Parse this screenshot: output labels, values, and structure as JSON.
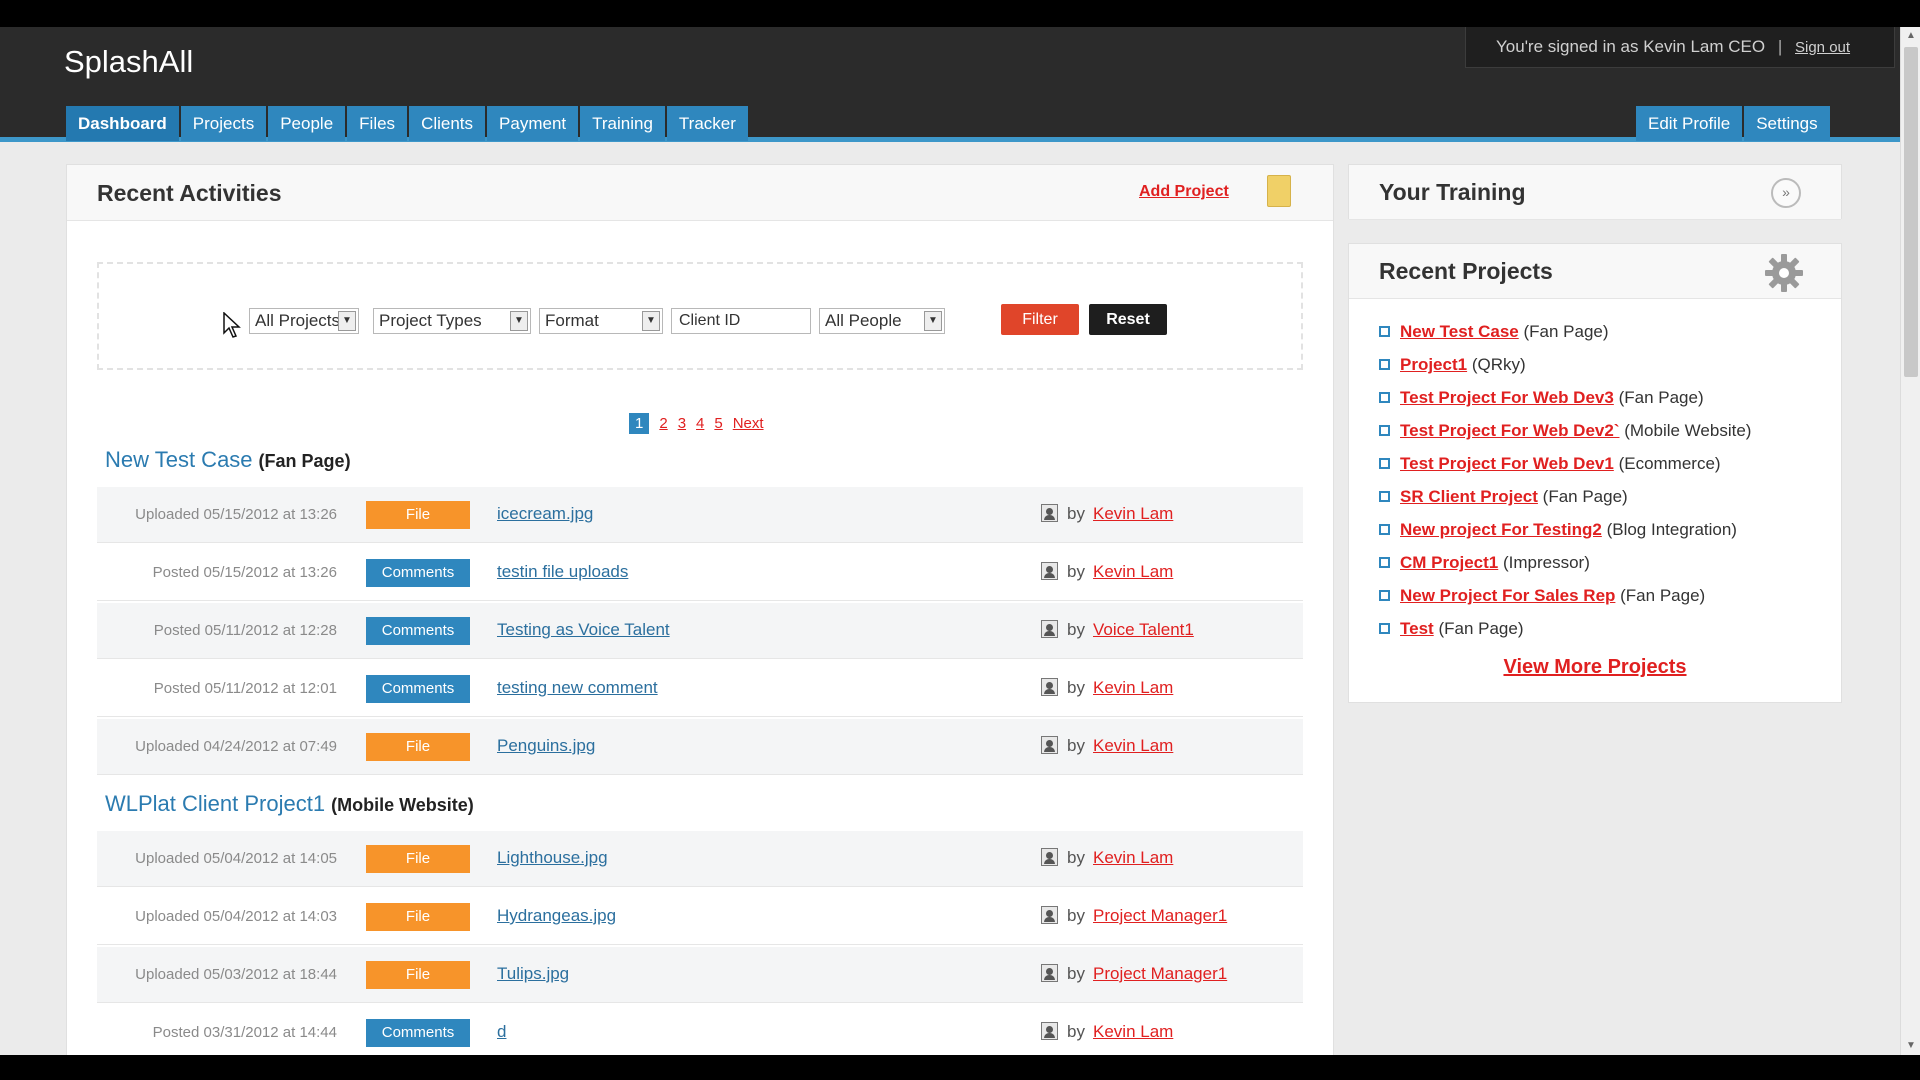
{
  "header": {
    "logo": "SplashAll",
    "user_text": "You're signed in as Kevin Lam CEO",
    "separator": "|",
    "sign_out": "Sign out"
  },
  "nav": {
    "tabs": [
      "Dashboard",
      "Projects",
      "People",
      "Files",
      "Clients",
      "Payment",
      "Training",
      "Tracker"
    ],
    "active": "Dashboard",
    "right_tabs": [
      "Edit Profile",
      "Settings"
    ]
  },
  "activities": {
    "title": "Recent Activities",
    "add_project": "Add Project",
    "filters": {
      "projects": "All Projects",
      "types": "Project Types",
      "format": "Format",
      "client_id_placeholder": "Client ID",
      "people": "All People",
      "filter_btn": "Filter",
      "reset_btn": "Reset"
    },
    "pager": {
      "pages": [
        "1",
        "2",
        "3",
        "4",
        "5"
      ],
      "current": "1",
      "next": "Next"
    },
    "groups": [
      {
        "name": "New Test Case",
        "type": "(Fan Page)",
        "rows": [
          {
            "ts": "Uploaded 05/15/2012 at 13:26",
            "kind": "File",
            "item": "icecream.jpg",
            "by": "by",
            "who": "Kevin Lam"
          },
          {
            "ts": "Posted 05/15/2012 at 13:26",
            "kind": "Comments",
            "item": "testin file uploads",
            "by": "by",
            "who": "Kevin Lam"
          },
          {
            "ts": "Posted 05/11/2012 at 12:28",
            "kind": "Comments",
            "item": "Testing as Voice Talent",
            "by": "by",
            "who": "Voice Talent1"
          },
          {
            "ts": "Posted 05/11/2012 at 12:01",
            "kind": "Comments",
            "item": "testing new comment",
            "by": "by",
            "who": "Kevin Lam"
          },
          {
            "ts": "Uploaded 04/24/2012 at 07:49",
            "kind": "File",
            "item": "Penguins.jpg",
            "by": "by",
            "who": "Kevin Lam"
          }
        ]
      },
      {
        "name": "WLPlat Client Project1",
        "type": "(Mobile Website)",
        "rows": [
          {
            "ts": "Uploaded 05/04/2012 at 14:05",
            "kind": "File",
            "item": "Lighthouse.jpg",
            "by": "by",
            "who": "Kevin Lam"
          },
          {
            "ts": "Uploaded 05/04/2012 at 14:03",
            "kind": "File",
            "item": "Hydrangeas.jpg",
            "by": "by",
            "who": "Project Manager1"
          },
          {
            "ts": "Uploaded 05/03/2012 at 18:44",
            "kind": "File",
            "item": "Tulips.jpg",
            "by": "by",
            "who": "Project Manager1"
          },
          {
            "ts": "Posted 03/31/2012 at 14:44",
            "kind": "Comments",
            "item": "d",
            "by": "by",
            "who": "Kevin Lam"
          }
        ]
      }
    ]
  },
  "training": {
    "title": "Your Training",
    "collapse_icon": "chevron-down-icon"
  },
  "recent_projects": {
    "title": "Recent Projects",
    "items": [
      {
        "name": "New Test Case",
        "type": "(Fan Page)"
      },
      {
        "name": "Project1",
        "type": "(QRky)"
      },
      {
        "name": "Test Project For Web Dev3",
        "type": "(Fan Page)"
      },
      {
        "name": "Test Project For Web Dev2`",
        "type": "(Mobile Website)"
      },
      {
        "name": "Test Project For Web Dev1",
        "type": "(Ecommerce)"
      },
      {
        "name": "SR Client Project",
        "type": "(Fan Page)"
      },
      {
        "name": "New project For Testing2",
        "type": "(Blog Integration)"
      },
      {
        "name": "CM Project1",
        "type": "(Impressor)"
      },
      {
        "name": "New Project For Sales Rep",
        "type": "(Fan Page)"
      },
      {
        "name": "Test",
        "type": "(Fan Page)"
      }
    ],
    "view_more": "View More Projects"
  },
  "colors": {
    "accent": "#2f87be",
    "link_red": "#e02020",
    "file_badge": "#f7942a",
    "filter_btn": "#e0452a",
    "header_bg": "#2b2b2b"
  }
}
